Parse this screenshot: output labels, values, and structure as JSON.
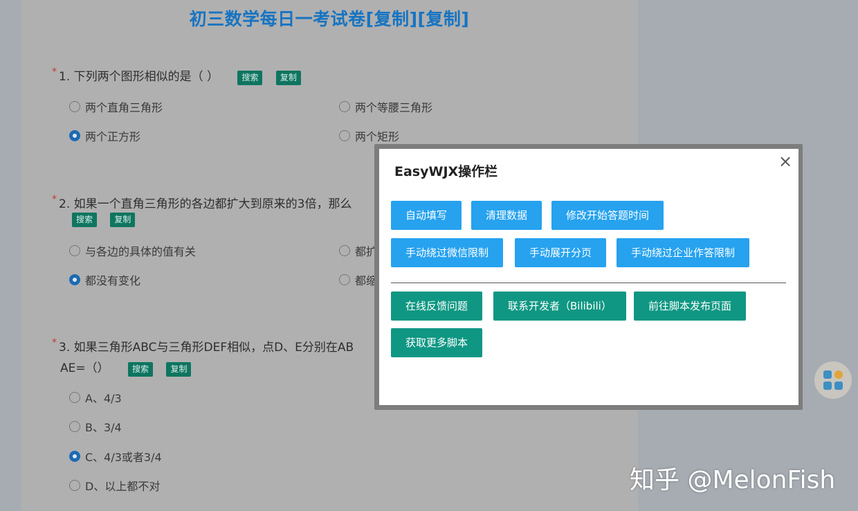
{
  "survey": {
    "title": "初三数学每日一考试卷[复制][复制]",
    "search_label": "搜索",
    "copy_label": "复制",
    "required_mark": "*",
    "questions": [
      {
        "text": "1. 下列两个图形相似的是（ ）",
        "options": [
          "两个直角三角形",
          "两个等腰三角形",
          "两个正方形",
          "两个矩形"
        ],
        "selected": "两个正方形"
      },
      {
        "text": "2. 如果一个直角三角形的各边都扩大到原来的3倍，那么",
        "options": [
          "与各边的具体的值有关",
          "都扩",
          "都没有变化",
          "都缩"
        ],
        "selected": "都没有变化"
      },
      {
        "text": "3. 如果三角形ABC与三角形DEF相似，点D、E分别在AB",
        "text_line2": "AE=（）",
        "options": [
          "A、4/3",
          "B、3/4",
          "C、4/3或者3/4",
          "D、以上都不对"
        ],
        "selected": "C、4/3或者3/4"
      }
    ]
  },
  "panel": {
    "title": "EasyWJX操作栏",
    "close_label": "×",
    "row1": [
      "自动填写",
      "清理数据",
      "修改开始答题时间"
    ],
    "row2": [
      "手动绕过微信限制",
      "手动展开分页",
      "手动绕过企业作答限制"
    ],
    "row3": [
      "在线反馈问题",
      "联系开发者（Bilibili）",
      "前往脚本发布页面"
    ],
    "row4": [
      "获取更多脚本"
    ]
  },
  "watermark": "知乎 @MelonFish",
  "colors": {
    "primary_blue": "#26a2ef",
    "teal": "#0f9783",
    "title_blue": "#1674c2",
    "tag_green": "#0e7560"
  }
}
